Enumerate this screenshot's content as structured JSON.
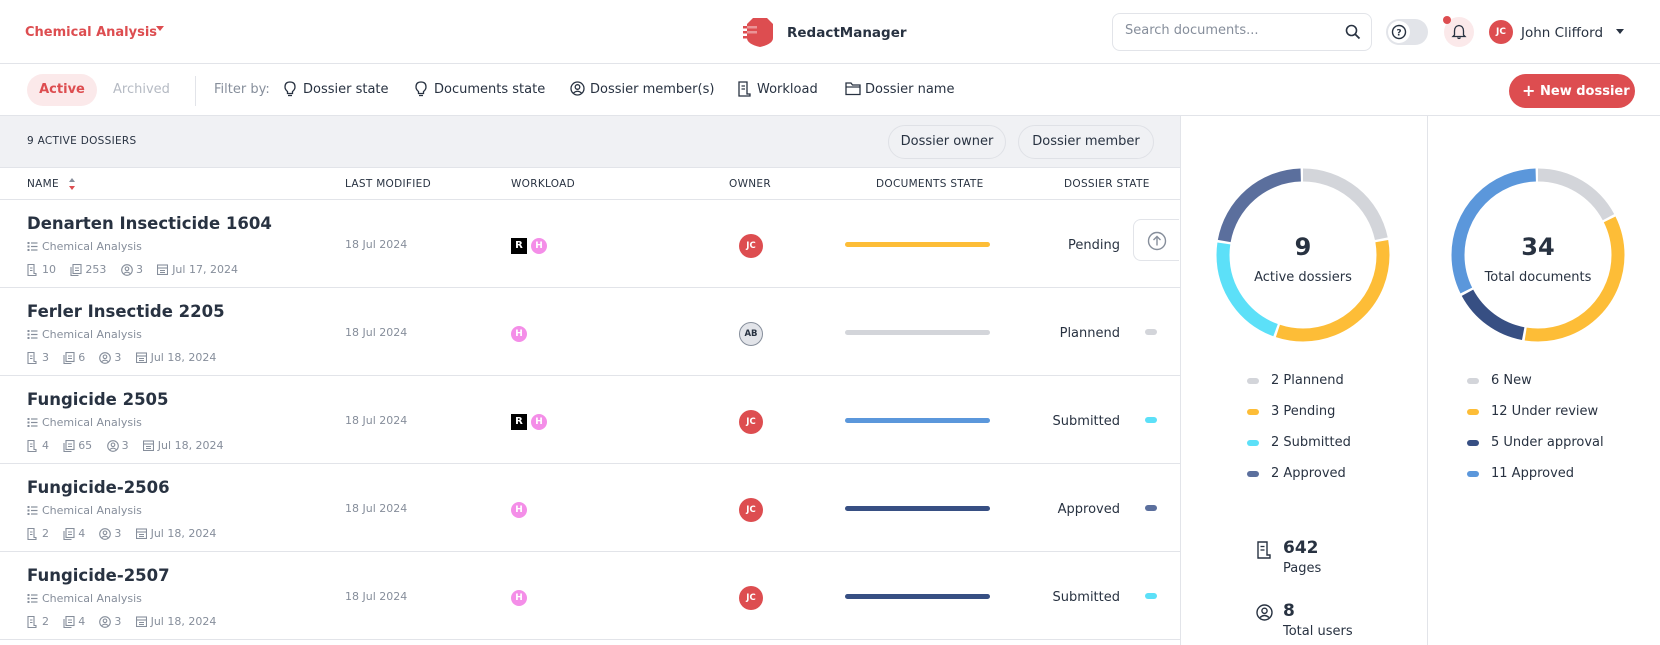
{
  "header": {
    "workspace": "Chemical Analysis",
    "brand": "RedactManager",
    "search_placeholder": "Search documents...",
    "user_initials": "JC",
    "user_name": "John Clifford"
  },
  "filters": {
    "tab_active": "Active",
    "tab_archived": "Archived",
    "filter_label": "Filter by:",
    "items": [
      "Dossier state",
      "Documents state",
      "Dossier member(s)",
      "Workload",
      "Dossier name"
    ],
    "new_button": "New dossier"
  },
  "table": {
    "count_label": "9 ACTIVE DOSSIERS",
    "owner_btn": "Dossier owner",
    "member_btn": "Dossier member",
    "columns": [
      "NAME",
      "LAST MODIFIED",
      "WORKLOAD",
      "OWNER",
      "DOCUMENTS STATE",
      "DOSSIER STATE"
    ],
    "rows": [
      {
        "name": "Denarten Insecticide 1604",
        "template": "Chemical Analysis",
        "files": "10",
        "pages": "253",
        "members": "3",
        "created": "Jul 17, 2024",
        "modified": "18 Jul 2024",
        "workload": [
          "R",
          "H"
        ],
        "owner": "JC",
        "owner_style": "red",
        "doc_bar_color": "#fdbd37",
        "state": "Pending",
        "state_color": "#fdbd37"
      },
      {
        "name": "Ferler Insectide 2205",
        "template": "Chemical Analysis",
        "files": "3",
        "pages": "6",
        "members": "3",
        "created": "Jul 18, 2024",
        "modified": "18 Jul 2024",
        "workload": [
          "H"
        ],
        "owner": "AB",
        "owner_style": "gray",
        "doc_bar_color": "#d3d5da",
        "state": "Plannend",
        "state_color": "#d3d5da"
      },
      {
        "name": "Fungicide 2505",
        "template": "Chemical Analysis",
        "files": "4",
        "pages": "65",
        "members": "3",
        "created": "Jul 18, 2024",
        "modified": "18 Jul 2024",
        "workload": [
          "R",
          "H"
        ],
        "owner": "JC",
        "owner_style": "red",
        "doc_bar_color": "#5b97db",
        "state": "Submitted",
        "state_color": "#5ce0f8"
      },
      {
        "name": "Fungicide-2506",
        "template": "Chemical Analysis",
        "files": "2",
        "pages": "4",
        "members": "3",
        "created": "Jul 18, 2024",
        "modified": "18 Jul 2024",
        "workload": [
          "H"
        ],
        "owner": "JC",
        "owner_style": "red",
        "doc_bar_color": "#374f83",
        "state": "Approved",
        "state_color": "#5b6f9d"
      },
      {
        "name": "Fungicide-2507",
        "template": "Chemical Analysis",
        "files": "2",
        "pages": "4",
        "members": "3",
        "created": "Jul 18, 2024",
        "modified": "18 Jul 2024",
        "workload": [
          "H"
        ],
        "owner": "JC",
        "owner_style": "red",
        "doc_bar_color": "#374f83",
        "state": "Submitted",
        "state_color": "#5ce0f8"
      }
    ]
  },
  "stats": {
    "dossiers": {
      "total": "9",
      "label": "Active dossiers",
      "segments": [
        {
          "label": "2 Plannend",
          "value": 2,
          "color": "#d3d5da"
        },
        {
          "label": "3 Pending",
          "value": 3,
          "color": "#fdbd37"
        },
        {
          "label": "2 Submitted",
          "value": 2,
          "color": "#5ce0f8"
        },
        {
          "label": "2 Approved",
          "value": 2,
          "color": "#5b6f9d"
        }
      ]
    },
    "documents": {
      "total": "34",
      "label": "Total documents",
      "segments": [
        {
          "label": "6 New",
          "value": 6,
          "color": "#d3d5da"
        },
        {
          "label": "12 Under review",
          "value": 12,
          "color": "#fdbd37"
        },
        {
          "label": "5 Under approval",
          "value": 5,
          "color": "#374f83"
        },
        {
          "label": "11 Approved",
          "value": 11,
          "color": "#5b97db"
        }
      ]
    },
    "pages": {
      "value": "642",
      "label": "Pages"
    },
    "users": {
      "value": "8",
      "label": "Total users"
    }
  }
}
